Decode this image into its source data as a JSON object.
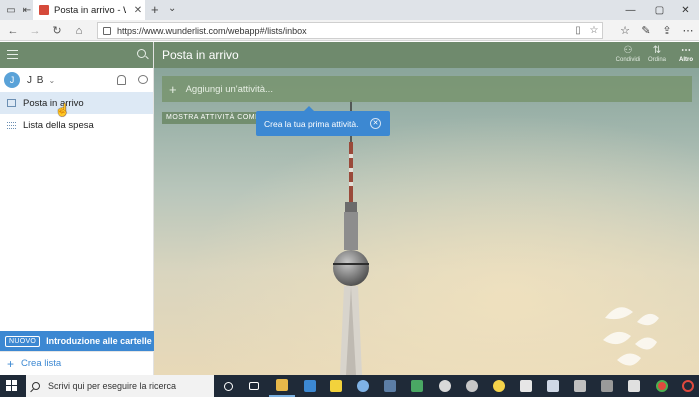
{
  "browser": {
    "tab_title": "Posta in arrivo - Wunde",
    "url": "https://www.wunderlist.com/webapp#/lists/inbox"
  },
  "sidebar": {
    "user_initial": "J",
    "user_name": "J B",
    "lists": [
      {
        "label": "Posta in arrivo",
        "active": true
      },
      {
        "label": "Lista della spesa",
        "active": false
      }
    ],
    "promo_badge": "NUOVO",
    "promo_text": "Introduzione alle cartelle",
    "create_list": "Crea lista"
  },
  "main": {
    "title": "Posta in arrivo",
    "actions": [
      {
        "label": "Condividi",
        "icon": "share-icon"
      },
      {
        "label": "Ordina",
        "icon": "sort-icon"
      },
      {
        "label": "Altro",
        "icon": "more-icon"
      }
    ],
    "add_task_placeholder": "Aggiungi un'attività...",
    "show_completed": "MOSTRA ATTIVITÀ COMPLE",
    "tooltip": "Crea la tua prima attività."
  },
  "taskbar": {
    "search_placeholder": "Scrivi qui per eseguire la ricerca"
  },
  "colors": {
    "accent": "#3c88d2",
    "header_green": "#6f8a6d",
    "taskbar": "#1f2a38"
  }
}
